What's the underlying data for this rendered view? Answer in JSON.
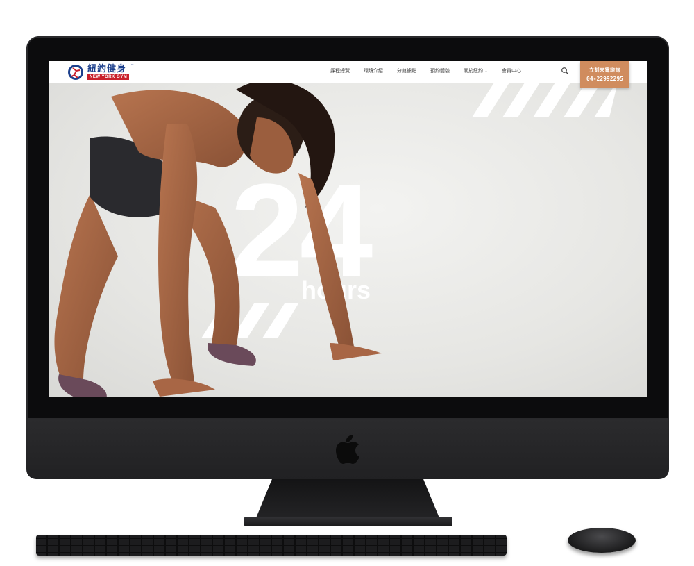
{
  "brand": {
    "name_cn": "紐約健身",
    "name_en": "NEW YORK GYM",
    "trademark": "™"
  },
  "nav": {
    "items": [
      {
        "label": "課程總覽"
      },
      {
        "label": "環境介紹"
      },
      {
        "label": "分館據點"
      },
      {
        "label": "預約體驗"
      },
      {
        "label": "關於紐約",
        "has_dropdown": true
      },
      {
        "label": "會員中心"
      }
    ],
    "search_icon": "search-icon",
    "cta": {
      "line1": "立刻來電諮詢",
      "line2": "04-22992295"
    }
  },
  "hero": {
    "big_number": "24",
    "subtitle": "hours"
  },
  "colors": {
    "cta_bg": "#d08c5e",
    "brand_blue": "#1c3f8c",
    "brand_red": "#c9202b",
    "hero_bg": "#ececea"
  }
}
